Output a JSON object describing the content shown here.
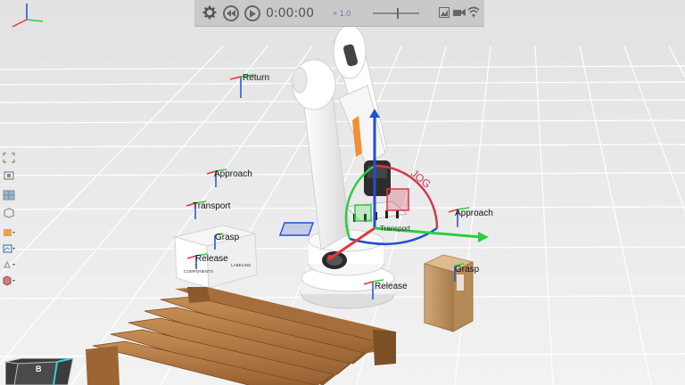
{
  "toolbar": {
    "time": "0:00:00",
    "speed": "× 1.0",
    "icons": [
      "gear-icon",
      "rewind-icon",
      "play-icon",
      "snapshot-icon",
      "camera-icon",
      "signal-icon"
    ]
  },
  "sidebar": {
    "icons": [
      "expand-icon",
      "fit-icon",
      "grid-icon",
      "box-icon",
      "layers-icon",
      "eye-icon",
      "rotate-icon",
      "cube-icon"
    ]
  },
  "scene": {
    "labels": {
      "return": "Return",
      "approach_left": "Approach",
      "transport": "Transport",
      "grasp_left": "Grasp",
      "release_left": "Release",
      "approach_right": "Approach",
      "grasp_right": "Grasp",
      "release_mid": "Release",
      "transport_small": "Transport",
      "jog": "JOG"
    },
    "box_text": {
      "left_face": "COMPONENTS",
      "right_face": "LABELING"
    }
  },
  "view_cube": {
    "face": "B"
  },
  "colors": {
    "background": "#ececec",
    "toolbar": "#c9c9c9",
    "jog": "#d23a4f",
    "axis_x": "#e53935",
    "axis_y": "#2ecc40",
    "axis_z": "#1e4fd6",
    "pallet": "#b07a45"
  }
}
